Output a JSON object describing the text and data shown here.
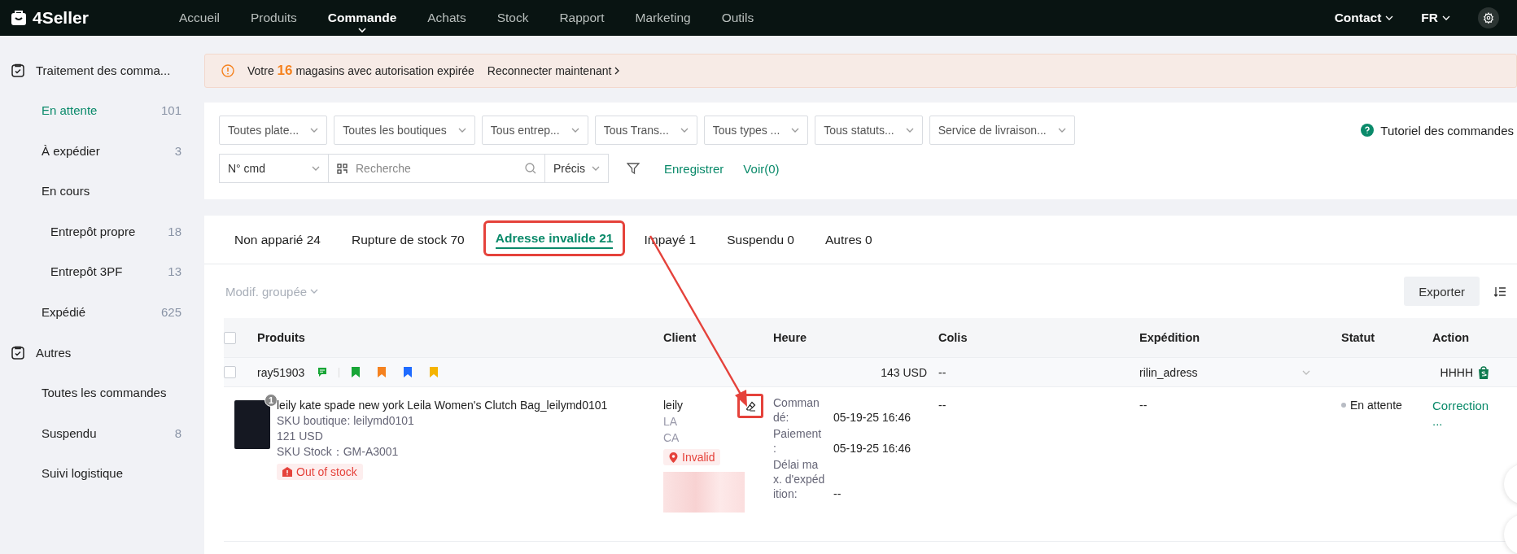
{
  "top_nav": {
    "logo": "4Seller",
    "menu": [
      {
        "label": "Accueil",
        "selected": false
      },
      {
        "label": "Produits",
        "selected": false
      },
      {
        "label": "Commande",
        "selected": true
      },
      {
        "label": "Achats",
        "selected": false
      },
      {
        "label": "Stock",
        "selected": false
      },
      {
        "label": "Rapport",
        "selected": false
      },
      {
        "label": "Marketing",
        "selected": false
      },
      {
        "label": "Outils",
        "selected": false
      }
    ],
    "contact": "Contact",
    "language": "FR"
  },
  "sidebar": {
    "groups": [
      {
        "title": "Traitement des comma...",
        "items": [
          {
            "label": "En attente",
            "count": "101",
            "selected": true
          },
          {
            "label": "À expédier",
            "count": "3",
            "selected": false
          },
          {
            "label": "En cours",
            "selected": false,
            "children": [
              {
                "label": "Entrepôt propre",
                "count": "18",
                "selected": false
              },
              {
                "label": "Entrepôt 3PF",
                "count": "13",
                "selected": false
              }
            ]
          },
          {
            "label": "Expédié",
            "count": "625",
            "selected": false
          }
        ]
      },
      {
        "title": "Autres",
        "items": [
          {
            "label": "Toutes les commandes",
            "selected": false
          },
          {
            "label": "Suspendu",
            "count": "8",
            "selected": false
          },
          {
            "label": "Suivi logistique",
            "selected": false
          }
        ]
      }
    ]
  },
  "banner": {
    "text": "Votre **16** magasins avec autorisation expirée",
    "link": "Reconnecter maintenant"
  },
  "filters": {
    "dropdowns": [
      "Toutes plate...",
      "Toutes les boutiques",
      "Tous entrep...",
      "Tous Trans...",
      "Tous types ...",
      "Tous statuts...",
      "Service de livraison..."
    ],
    "help": "Tutoriel des commandes",
    "search_type": "N° cmd",
    "search_placeholder": "Recherche",
    "match": "Précis",
    "save": "Enregistrer",
    "view": "Voir(0)"
  },
  "tabs": [
    {
      "label": "Non apparié 24",
      "selected": false,
      "highlighted": false
    },
    {
      "label": "Rupture de stock 70",
      "selected": false,
      "highlighted": false
    },
    {
      "label": "Adresse invalide 21",
      "selected": true,
      "highlighted": true
    },
    {
      "label": "Impayé 1",
      "selected": false,
      "highlighted": false
    },
    {
      "label": "Suspendu 0",
      "selected": false,
      "highlighted": false
    },
    {
      "label": "Autres 0",
      "selected": false,
      "highlighted": false
    }
  ],
  "toolbar": {
    "bulk_edit": "Modif. groupée",
    "export": "Exporter"
  },
  "table": {
    "select_all_checked": false,
    "columns": [
      "Produits",
      "Client",
      "Heure",
      "Colis",
      "Expédition",
      "Statut",
      "Action"
    ],
    "groups": [
      {
        "store": "ray51903",
        "checked": false,
        "flags": [
          {
            "color": "#18a637"
          },
          {
            "color": "#f5821f"
          },
          {
            "color": "#1f6bff"
          },
          {
            "color": "#f5b400"
          }
        ],
        "amount": "143 USD",
        "parcel": "--",
        "shipping": "rilin_adress",
        "shop": "HHHH",
        "order": {
          "quantity": "1",
          "title": "leily kate spade new york Leila Women's Clutch Bag_leilymd0101",
          "sku_shop": "SKU boutique: leilymd0101",
          "price": "121 USD",
          "sku_stock": "SKU Stock：GM-A3001",
          "stock_badge": "Out of stock",
          "client": {
            "name": "leily",
            "city": "LA",
            "state": "CA",
            "address_badge": "Invalid",
            "edit_highlighted": true
          },
          "times": [
            {
              "label": "Commandé:",
              "value": "05-19-25 16:46"
            },
            {
              "label": "Paiement :",
              "value": "05-19-25 16:46"
            },
            {
              "label": "Délai max. d'expédition:",
              "value": "--"
            }
          ],
          "parcel": "--",
          "shipping": "--",
          "status": "En attente",
          "action": "Correction",
          "more": "..."
        }
      }
    ]
  }
}
